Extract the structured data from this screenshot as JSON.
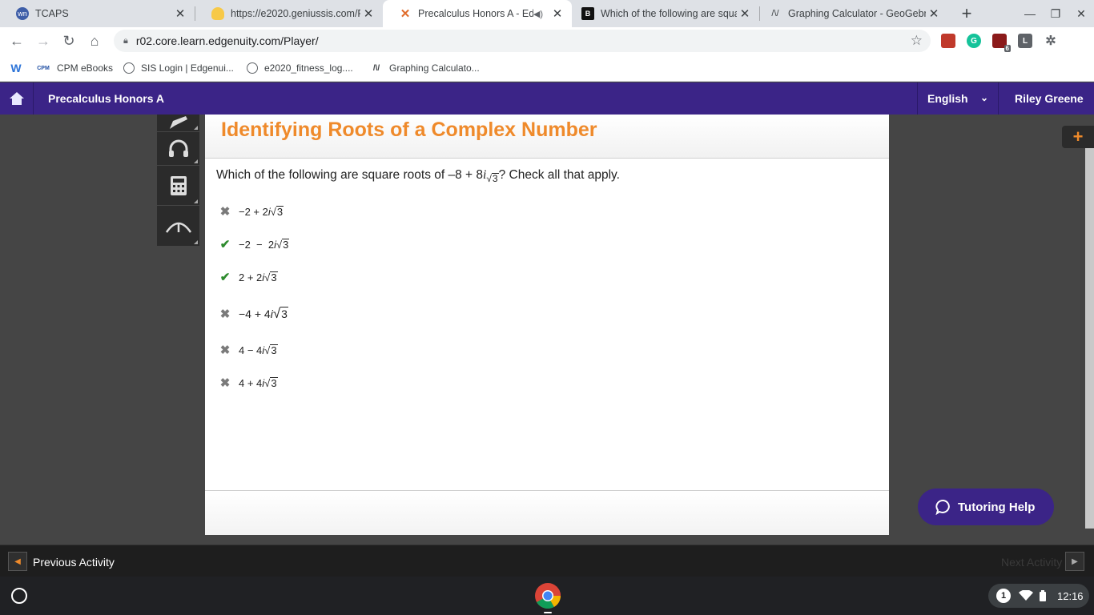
{
  "browser": {
    "tabs": [
      {
        "title": "TCAPS",
        "favicon_color": "#3e5ea8",
        "favicon_text": "wn"
      },
      {
        "title": "https://e2020.geniussis.com/F",
        "favicon_color": "#f7c948",
        "favicon_text": ""
      },
      {
        "title": "Precalculus Honors A - Edg",
        "favicon_color": "#e06b2a",
        "favicon_text": "✕",
        "active": true
      },
      {
        "title": "Which of the following are squa",
        "favicon_color": "#111111",
        "favicon_text": "B"
      },
      {
        "title": "Graphing Calculator - GeoGebra",
        "favicon_color": "#ffffff",
        "favicon_text": "/\\/"
      }
    ],
    "url": "r02.core.learn.edgenuity.com/Player/",
    "extension_badge": "6",
    "bookmarks": [
      {
        "label": "",
        "icon": "W"
      },
      {
        "label": "CPM eBooks",
        "icon": "CPM"
      },
      {
        "label": "SIS Login | Edgenui...",
        "icon": "globe"
      },
      {
        "label": "e2020_fitness_log....",
        "icon": "globe"
      },
      {
        "label": "Graphing Calculato...",
        "icon": "geogebra"
      }
    ]
  },
  "app": {
    "course": "Precalculus Honors A",
    "language": "English",
    "user": "Riley Greene",
    "lesson_title": "Identifying Roots of a Complex Number",
    "question": {
      "prefix": "Which of the following are square roots of –8 + 8",
      "imag": "i",
      "radicand": "3",
      "suffix": "? Check all that apply."
    },
    "options": [
      {
        "status": "wrong",
        "mark": "✖",
        "before": "−2 + 2",
        "i": "i",
        "radicand": "3",
        "after": ""
      },
      {
        "status": "correct",
        "mark": "✔",
        "before": "−2  −  2",
        "i": "i",
        "radicand": "3",
        "after": ""
      },
      {
        "status": "correct",
        "mark": "✔",
        "before": "2 + 2",
        "i": "i",
        "radicand": "3",
        "after": ""
      },
      {
        "status": "wrong",
        "mark": "✖",
        "before": "−4 + 4",
        "i": "i",
        "radicand": " 3",
        "after": ""
      },
      {
        "status": "wrong",
        "mark": "✖",
        "before": "4 − 4",
        "i": "i",
        "radicand": "3",
        "after": ""
      },
      {
        "status": "wrong",
        "mark": "✖",
        "before": "4 + 4",
        "i": "i",
        "radicand": "3",
        "after": ""
      }
    ],
    "tutoring_label": "Tutoring Help",
    "prev_label": "Previous Activity",
    "next_label": "Next Activity"
  },
  "system": {
    "notification_count": "1",
    "time": "12:16"
  }
}
